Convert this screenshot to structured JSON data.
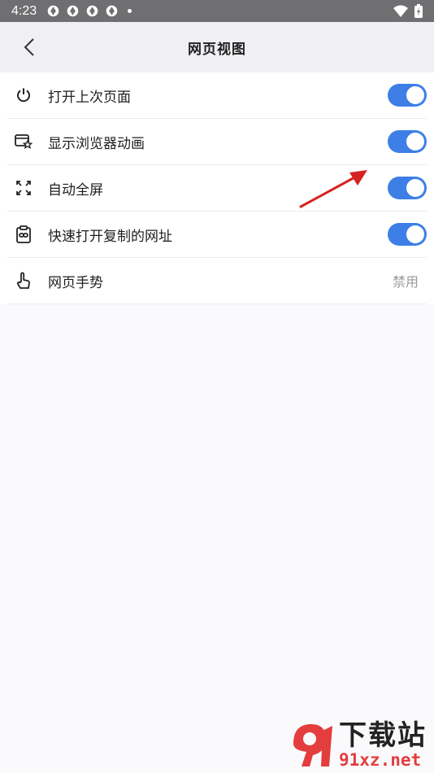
{
  "status_bar": {
    "time": "4:23"
  },
  "header": {
    "title": "网页视图"
  },
  "settings": [
    {
      "label": "打开上次页面",
      "icon": "power-icon",
      "toggle": true
    },
    {
      "label": "显示浏览器动画",
      "icon": "browser-star-icon",
      "toggle": true
    },
    {
      "label": "自动全屏",
      "icon": "fullscreen-icon",
      "toggle": true
    },
    {
      "label": "快速打开复制的网址",
      "icon": "clipboard-link-icon",
      "toggle": true
    },
    {
      "label": "网页手势",
      "icon": "hand-gesture-icon",
      "value": "禁用"
    }
  ],
  "watermark": {
    "cn": "下载站",
    "url": "91xz.net"
  },
  "colors": {
    "toggle_on": "#3d7fe6",
    "arrow": "#d62222",
    "statusbar": "#6f6f72"
  }
}
